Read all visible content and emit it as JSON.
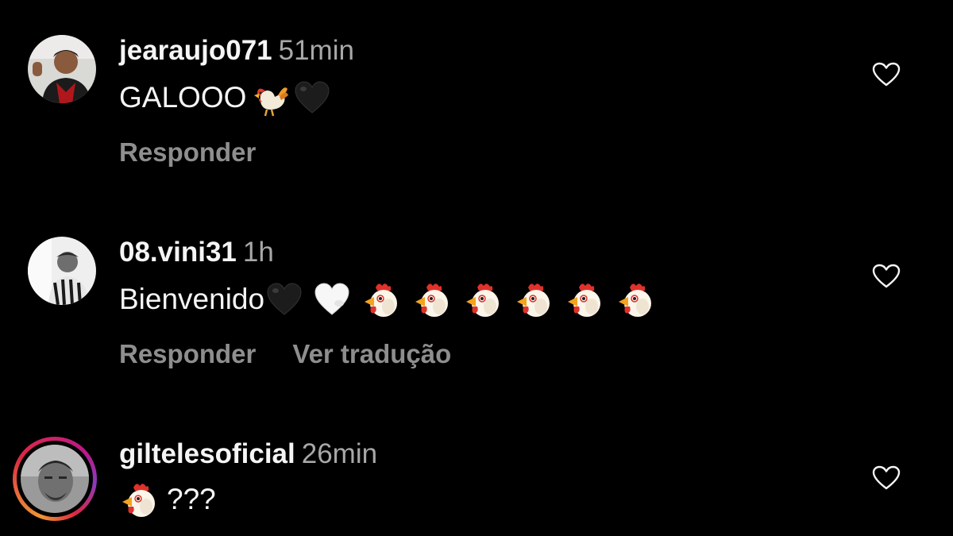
{
  "comments": [
    {
      "username": "jearaujo071",
      "time": "51min",
      "text": "GALOOO",
      "emojis": [
        "rooster-emoji",
        "black-heart-emoji"
      ],
      "actions": {
        "reply": "Responder"
      }
    },
    {
      "username": "08.vini31",
      "time": "1h",
      "text": "Bienvenido",
      "emojis": [
        "black-heart-emoji",
        "white-heart-emoji",
        "chicken-face-emoji",
        "chicken-face-emoji",
        "chicken-face-emoji",
        "chicken-face-emoji",
        "chicken-face-emoji",
        "chicken-face-emoji"
      ],
      "actions": {
        "reply": "Responder",
        "translate": "Ver tradução"
      }
    },
    {
      "username": "giltelesoficial",
      "time": "26min",
      "text": "???",
      "emojis": [
        "chicken-face-emoji"
      ],
      "has_story_ring": true
    }
  ],
  "icons": {
    "like": "heart-outline-icon"
  },
  "colors": {
    "background": "#000000",
    "primary_text": "#f5f5f5",
    "secondary_text": "#a8a8a8",
    "action_text": "#8e8e8e"
  }
}
